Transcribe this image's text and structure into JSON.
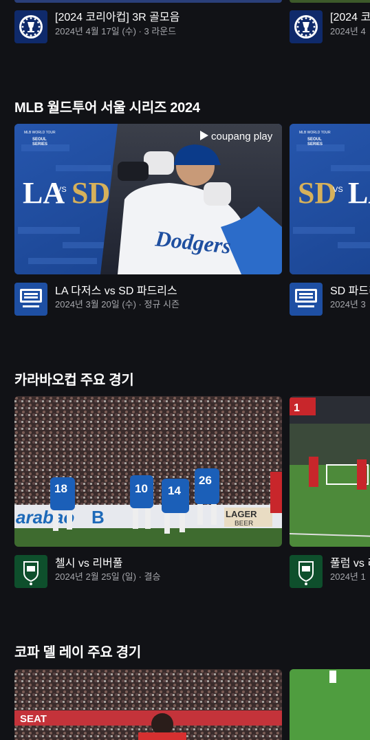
{
  "row0": {
    "cards": [
      {
        "title": "[2024 코리아컵] 3R 골모음",
        "meta": "2024년 4월 17일 (수) · 3 라운드"
      },
      {
        "title": "[2024 코",
        "meta": "2024년 4"
      }
    ]
  },
  "section_mlb": {
    "title": "MLB 월드투어 서울 시리즈 2024",
    "cards": [
      {
        "title": "LA 다저스 vs SD 파드리스",
        "meta": "2024년 3월 20일 (수) · 정규 시즌",
        "thumb_brand": "coupang play",
        "badge_line1": "MLB WORLD TOUR",
        "badge_line2": "SEOUL",
        "badge_line3": "SERIES",
        "team_a": "LA",
        "team_b": "SD",
        "vs": "VS",
        "jersey": "Dodgers"
      },
      {
        "title": "SD 파드리",
        "meta": "2024년 3",
        "badge_line1": "MLB WORLD TOUR",
        "badge_line2": "SEOUL",
        "badge_line3": "SERIES",
        "team_a": "SD",
        "team_b": "LA",
        "vs": "VS"
      }
    ]
  },
  "section_carabao": {
    "title": "카라바오컵 주요 경기",
    "cards": [
      {
        "title": "첼시 vs 리버풀",
        "meta": "2024년 2월 25일 (일) · 결승",
        "numbers": [
          "18",
          "10",
          "14",
          "26"
        ],
        "board_a": "arabao",
        "board_b": "B",
        "board_c": "LAGER",
        "board_d": "BEER"
      },
      {
        "title": "풀럼 vs 리",
        "meta": "2024년 1",
        "score": "1"
      }
    ]
  },
  "section_copa": {
    "title": "코파 델 레이 주요 경기",
    "board": "SEAT"
  },
  "colors": {
    "background": "#111216",
    "meta_text": "#a7a8ad",
    "mlb_blue": "#1e4fa3",
    "padres_gold": "#d6b15b",
    "carabao_green": "#0e4f2c"
  }
}
